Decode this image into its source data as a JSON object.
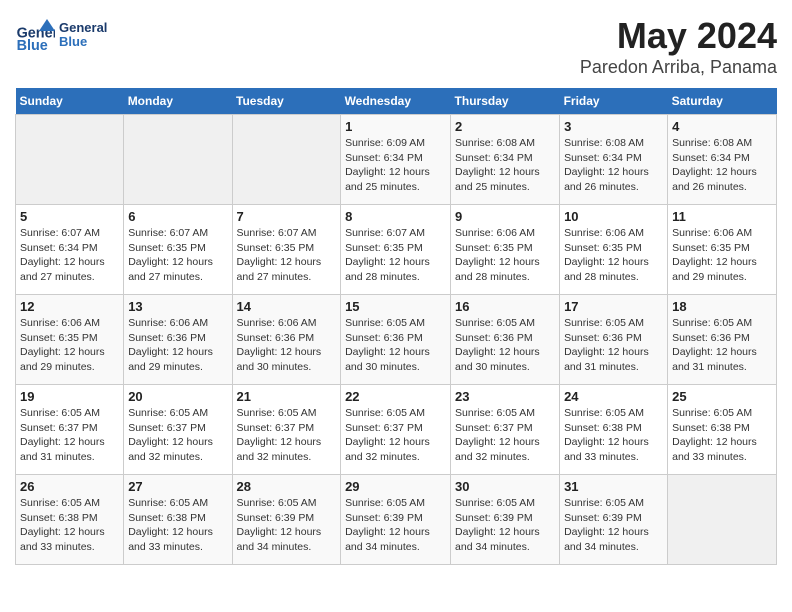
{
  "header": {
    "logo_text_general": "General",
    "logo_text_blue": "Blue",
    "title": "May 2024",
    "subtitle": "Paredon Arriba, Panama"
  },
  "calendar": {
    "days_of_week": [
      "Sunday",
      "Monday",
      "Tuesday",
      "Wednesday",
      "Thursday",
      "Friday",
      "Saturday"
    ],
    "weeks": [
      [
        {
          "day": null,
          "info": null
        },
        {
          "day": null,
          "info": null
        },
        {
          "day": null,
          "info": null
        },
        {
          "day": "1",
          "info": "Sunrise: 6:09 AM\nSunset: 6:34 PM\nDaylight: 12 hours\nand 25 minutes."
        },
        {
          "day": "2",
          "info": "Sunrise: 6:08 AM\nSunset: 6:34 PM\nDaylight: 12 hours\nand 25 minutes."
        },
        {
          "day": "3",
          "info": "Sunrise: 6:08 AM\nSunset: 6:34 PM\nDaylight: 12 hours\nand 26 minutes."
        },
        {
          "day": "4",
          "info": "Sunrise: 6:08 AM\nSunset: 6:34 PM\nDaylight: 12 hours\nand 26 minutes."
        }
      ],
      [
        {
          "day": "5",
          "info": "Sunrise: 6:07 AM\nSunset: 6:34 PM\nDaylight: 12 hours\nand 27 minutes."
        },
        {
          "day": "6",
          "info": "Sunrise: 6:07 AM\nSunset: 6:35 PM\nDaylight: 12 hours\nand 27 minutes."
        },
        {
          "day": "7",
          "info": "Sunrise: 6:07 AM\nSunset: 6:35 PM\nDaylight: 12 hours\nand 27 minutes."
        },
        {
          "day": "8",
          "info": "Sunrise: 6:07 AM\nSunset: 6:35 PM\nDaylight: 12 hours\nand 28 minutes."
        },
        {
          "day": "9",
          "info": "Sunrise: 6:06 AM\nSunset: 6:35 PM\nDaylight: 12 hours\nand 28 minutes."
        },
        {
          "day": "10",
          "info": "Sunrise: 6:06 AM\nSunset: 6:35 PM\nDaylight: 12 hours\nand 28 minutes."
        },
        {
          "day": "11",
          "info": "Sunrise: 6:06 AM\nSunset: 6:35 PM\nDaylight: 12 hours\nand 29 minutes."
        }
      ],
      [
        {
          "day": "12",
          "info": "Sunrise: 6:06 AM\nSunset: 6:35 PM\nDaylight: 12 hours\nand 29 minutes."
        },
        {
          "day": "13",
          "info": "Sunrise: 6:06 AM\nSunset: 6:36 PM\nDaylight: 12 hours\nand 29 minutes."
        },
        {
          "day": "14",
          "info": "Sunrise: 6:06 AM\nSunset: 6:36 PM\nDaylight: 12 hours\nand 30 minutes."
        },
        {
          "day": "15",
          "info": "Sunrise: 6:05 AM\nSunset: 6:36 PM\nDaylight: 12 hours\nand 30 minutes."
        },
        {
          "day": "16",
          "info": "Sunrise: 6:05 AM\nSunset: 6:36 PM\nDaylight: 12 hours\nand 30 minutes."
        },
        {
          "day": "17",
          "info": "Sunrise: 6:05 AM\nSunset: 6:36 PM\nDaylight: 12 hours\nand 31 minutes."
        },
        {
          "day": "18",
          "info": "Sunrise: 6:05 AM\nSunset: 6:36 PM\nDaylight: 12 hours\nand 31 minutes."
        }
      ],
      [
        {
          "day": "19",
          "info": "Sunrise: 6:05 AM\nSunset: 6:37 PM\nDaylight: 12 hours\nand 31 minutes."
        },
        {
          "day": "20",
          "info": "Sunrise: 6:05 AM\nSunset: 6:37 PM\nDaylight: 12 hours\nand 32 minutes."
        },
        {
          "day": "21",
          "info": "Sunrise: 6:05 AM\nSunset: 6:37 PM\nDaylight: 12 hours\nand 32 minutes."
        },
        {
          "day": "22",
          "info": "Sunrise: 6:05 AM\nSunset: 6:37 PM\nDaylight: 12 hours\nand 32 minutes."
        },
        {
          "day": "23",
          "info": "Sunrise: 6:05 AM\nSunset: 6:37 PM\nDaylight: 12 hours\nand 32 minutes."
        },
        {
          "day": "24",
          "info": "Sunrise: 6:05 AM\nSunset: 6:38 PM\nDaylight: 12 hours\nand 33 minutes."
        },
        {
          "day": "25",
          "info": "Sunrise: 6:05 AM\nSunset: 6:38 PM\nDaylight: 12 hours\nand 33 minutes."
        }
      ],
      [
        {
          "day": "26",
          "info": "Sunrise: 6:05 AM\nSunset: 6:38 PM\nDaylight: 12 hours\nand 33 minutes."
        },
        {
          "day": "27",
          "info": "Sunrise: 6:05 AM\nSunset: 6:38 PM\nDaylight: 12 hours\nand 33 minutes."
        },
        {
          "day": "28",
          "info": "Sunrise: 6:05 AM\nSunset: 6:39 PM\nDaylight: 12 hours\nand 34 minutes."
        },
        {
          "day": "29",
          "info": "Sunrise: 6:05 AM\nSunset: 6:39 PM\nDaylight: 12 hours\nand 34 minutes."
        },
        {
          "day": "30",
          "info": "Sunrise: 6:05 AM\nSunset: 6:39 PM\nDaylight: 12 hours\nand 34 minutes."
        },
        {
          "day": "31",
          "info": "Sunrise: 6:05 AM\nSunset: 6:39 PM\nDaylight: 12 hours\nand 34 minutes."
        },
        {
          "day": null,
          "info": null
        }
      ]
    ]
  }
}
